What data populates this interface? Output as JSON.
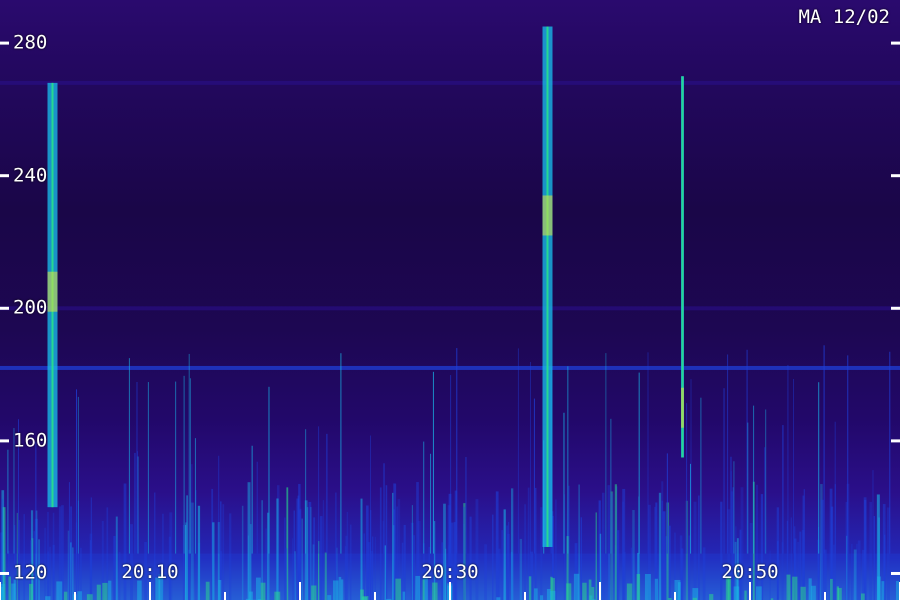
{
  "chart_data": {
    "type": "heatmap",
    "title": "",
    "annotation": "MA 12/02",
    "xlabel": "",
    "ylabel": "",
    "x_ticks": [
      "20:10",
      "20:30",
      "20:50"
    ],
    "x_tick_values_min": [
      10,
      30,
      50
    ],
    "xlim_min": [
      0,
      60
    ],
    "y_ticks": [
      120,
      160,
      200,
      240,
      280
    ],
    "ylim": [
      112,
      293
    ],
    "colormap": [
      "#1a0648",
      "#2a0f8a",
      "#1f3fd8",
      "#19b6e6",
      "#29e08a",
      "#e6e23a"
    ],
    "persistent_bands_y": [
      182,
      200,
      268
    ],
    "bright_signal_columns": [
      {
        "t_min": 3.5,
        "y_from": 140,
        "y_to": 268,
        "peak_y": 205
      },
      {
        "t_min": 36.5,
        "y_from": 128,
        "y_to": 285,
        "peak_y": 228
      },
      {
        "t_min": 45.5,
        "y_from": 155,
        "y_to": 270,
        "peak_y": 170
      }
    ]
  }
}
